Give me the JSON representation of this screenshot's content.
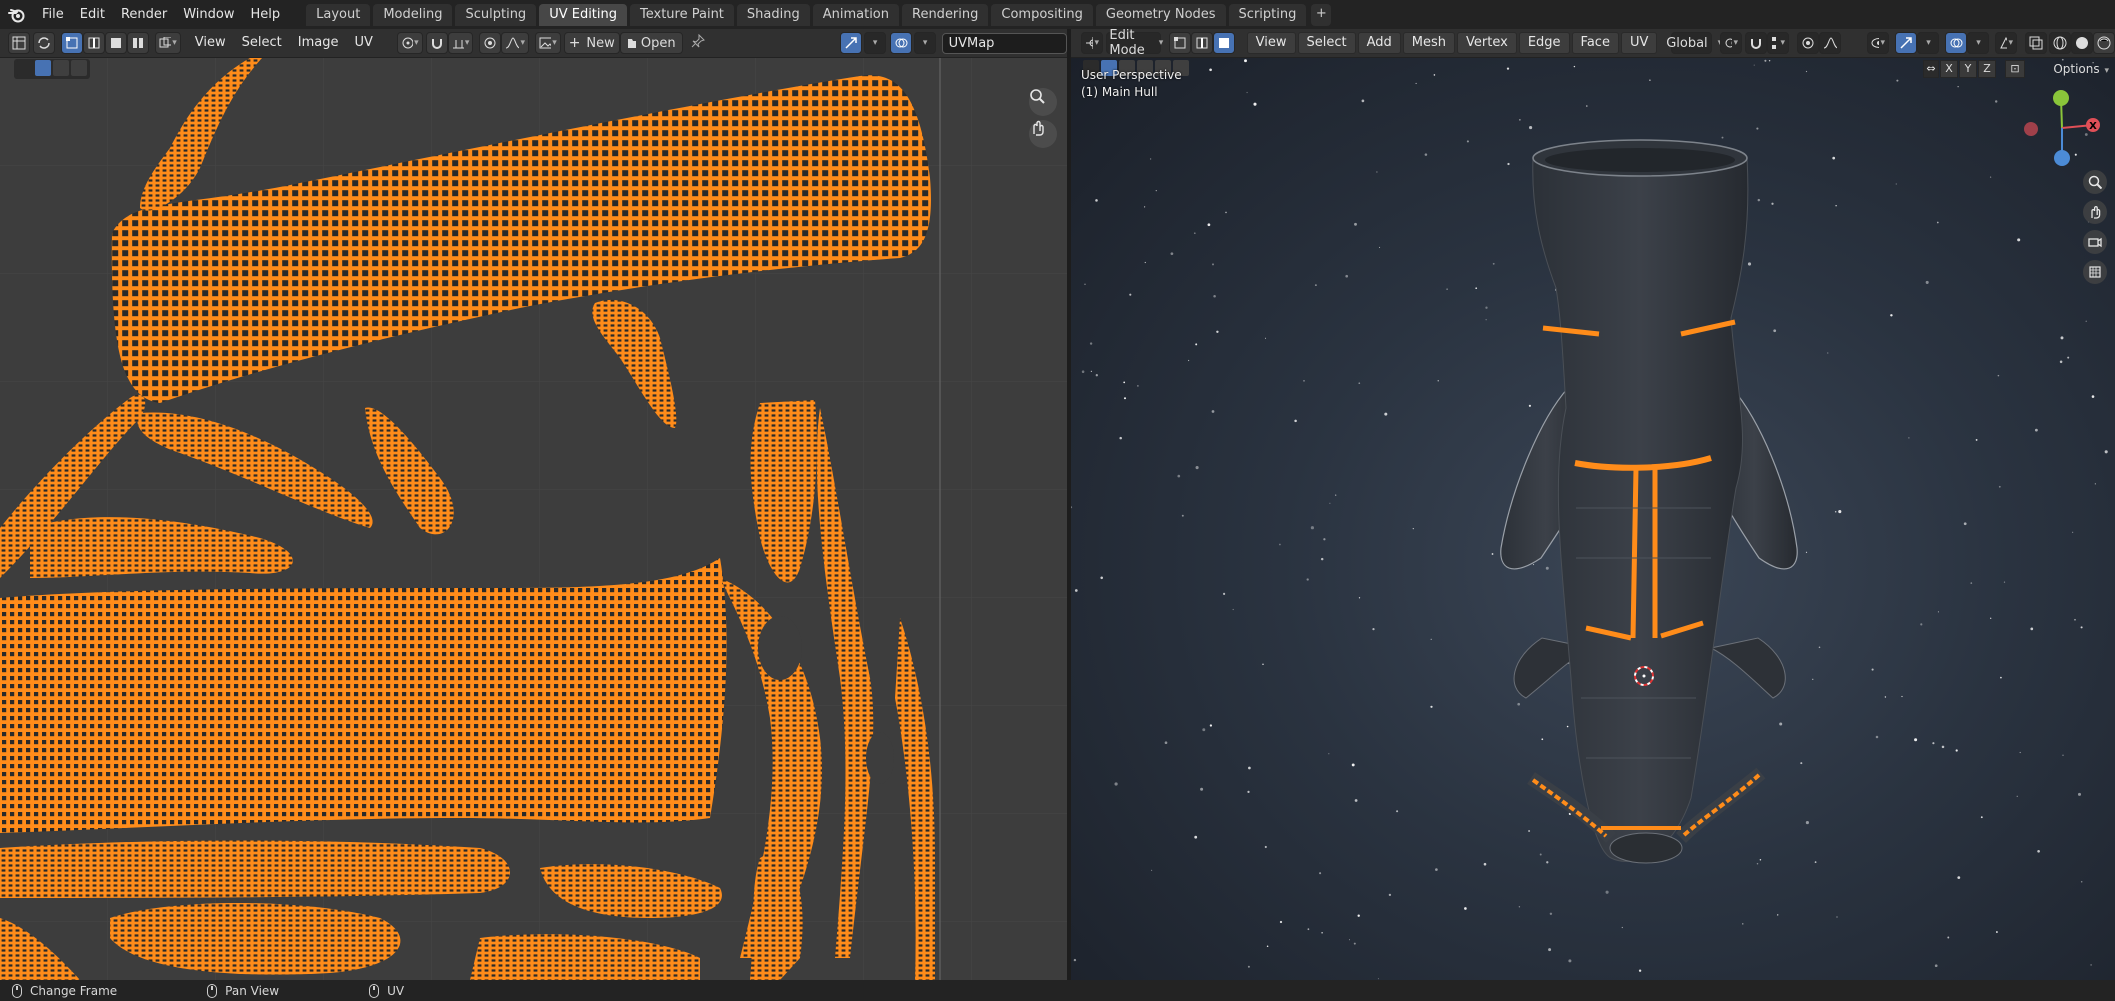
{
  "app": {
    "menus": [
      "File",
      "Edit",
      "Render",
      "Window",
      "Help"
    ],
    "workspace_tabs": [
      {
        "label": "Layout",
        "active": false
      },
      {
        "label": "Modeling",
        "active": false
      },
      {
        "label": "Sculpting",
        "active": false
      },
      {
        "label": "UV Editing",
        "active": true
      },
      {
        "label": "Texture Paint",
        "active": false
      },
      {
        "label": "Shading",
        "active": false
      },
      {
        "label": "Animation",
        "active": false
      },
      {
        "label": "Rendering",
        "active": false
      },
      {
        "label": "Compositing",
        "active": false
      },
      {
        "label": "Geometry Nodes",
        "active": false
      },
      {
        "label": "Scripting",
        "active": false
      }
    ],
    "add_tab_symbol": "+"
  },
  "uv_editor": {
    "menus": [
      "View",
      "Select",
      "Image",
      "UV"
    ],
    "new_label": "New",
    "open_label": "Open",
    "uv_map_name": "UVMap",
    "accent_color": "#ff8c1a"
  },
  "viewport": {
    "mode_label": "Edit Mode",
    "menus": [
      "View",
      "Select",
      "Add",
      "Mesh",
      "Vertex",
      "Edge",
      "Face",
      "UV"
    ],
    "orientation_label": "Global",
    "perspective_label": "User Perspective",
    "object_label": "(1) Main Hull",
    "axis_buttons": [
      "X",
      "Y",
      "Z"
    ],
    "options_label": "Options",
    "gizmo_colors": {
      "x": "#e04f57",
      "y": "#8ac53a",
      "z": "#4c8bd6"
    }
  },
  "statusbar": {
    "items": [
      {
        "icon": "mouse-left-icon",
        "label": "Change Frame"
      },
      {
        "icon": "mouse-middle-icon",
        "label": "Pan View"
      },
      {
        "icon": "mouse-right-icon",
        "label": "UV"
      }
    ]
  }
}
